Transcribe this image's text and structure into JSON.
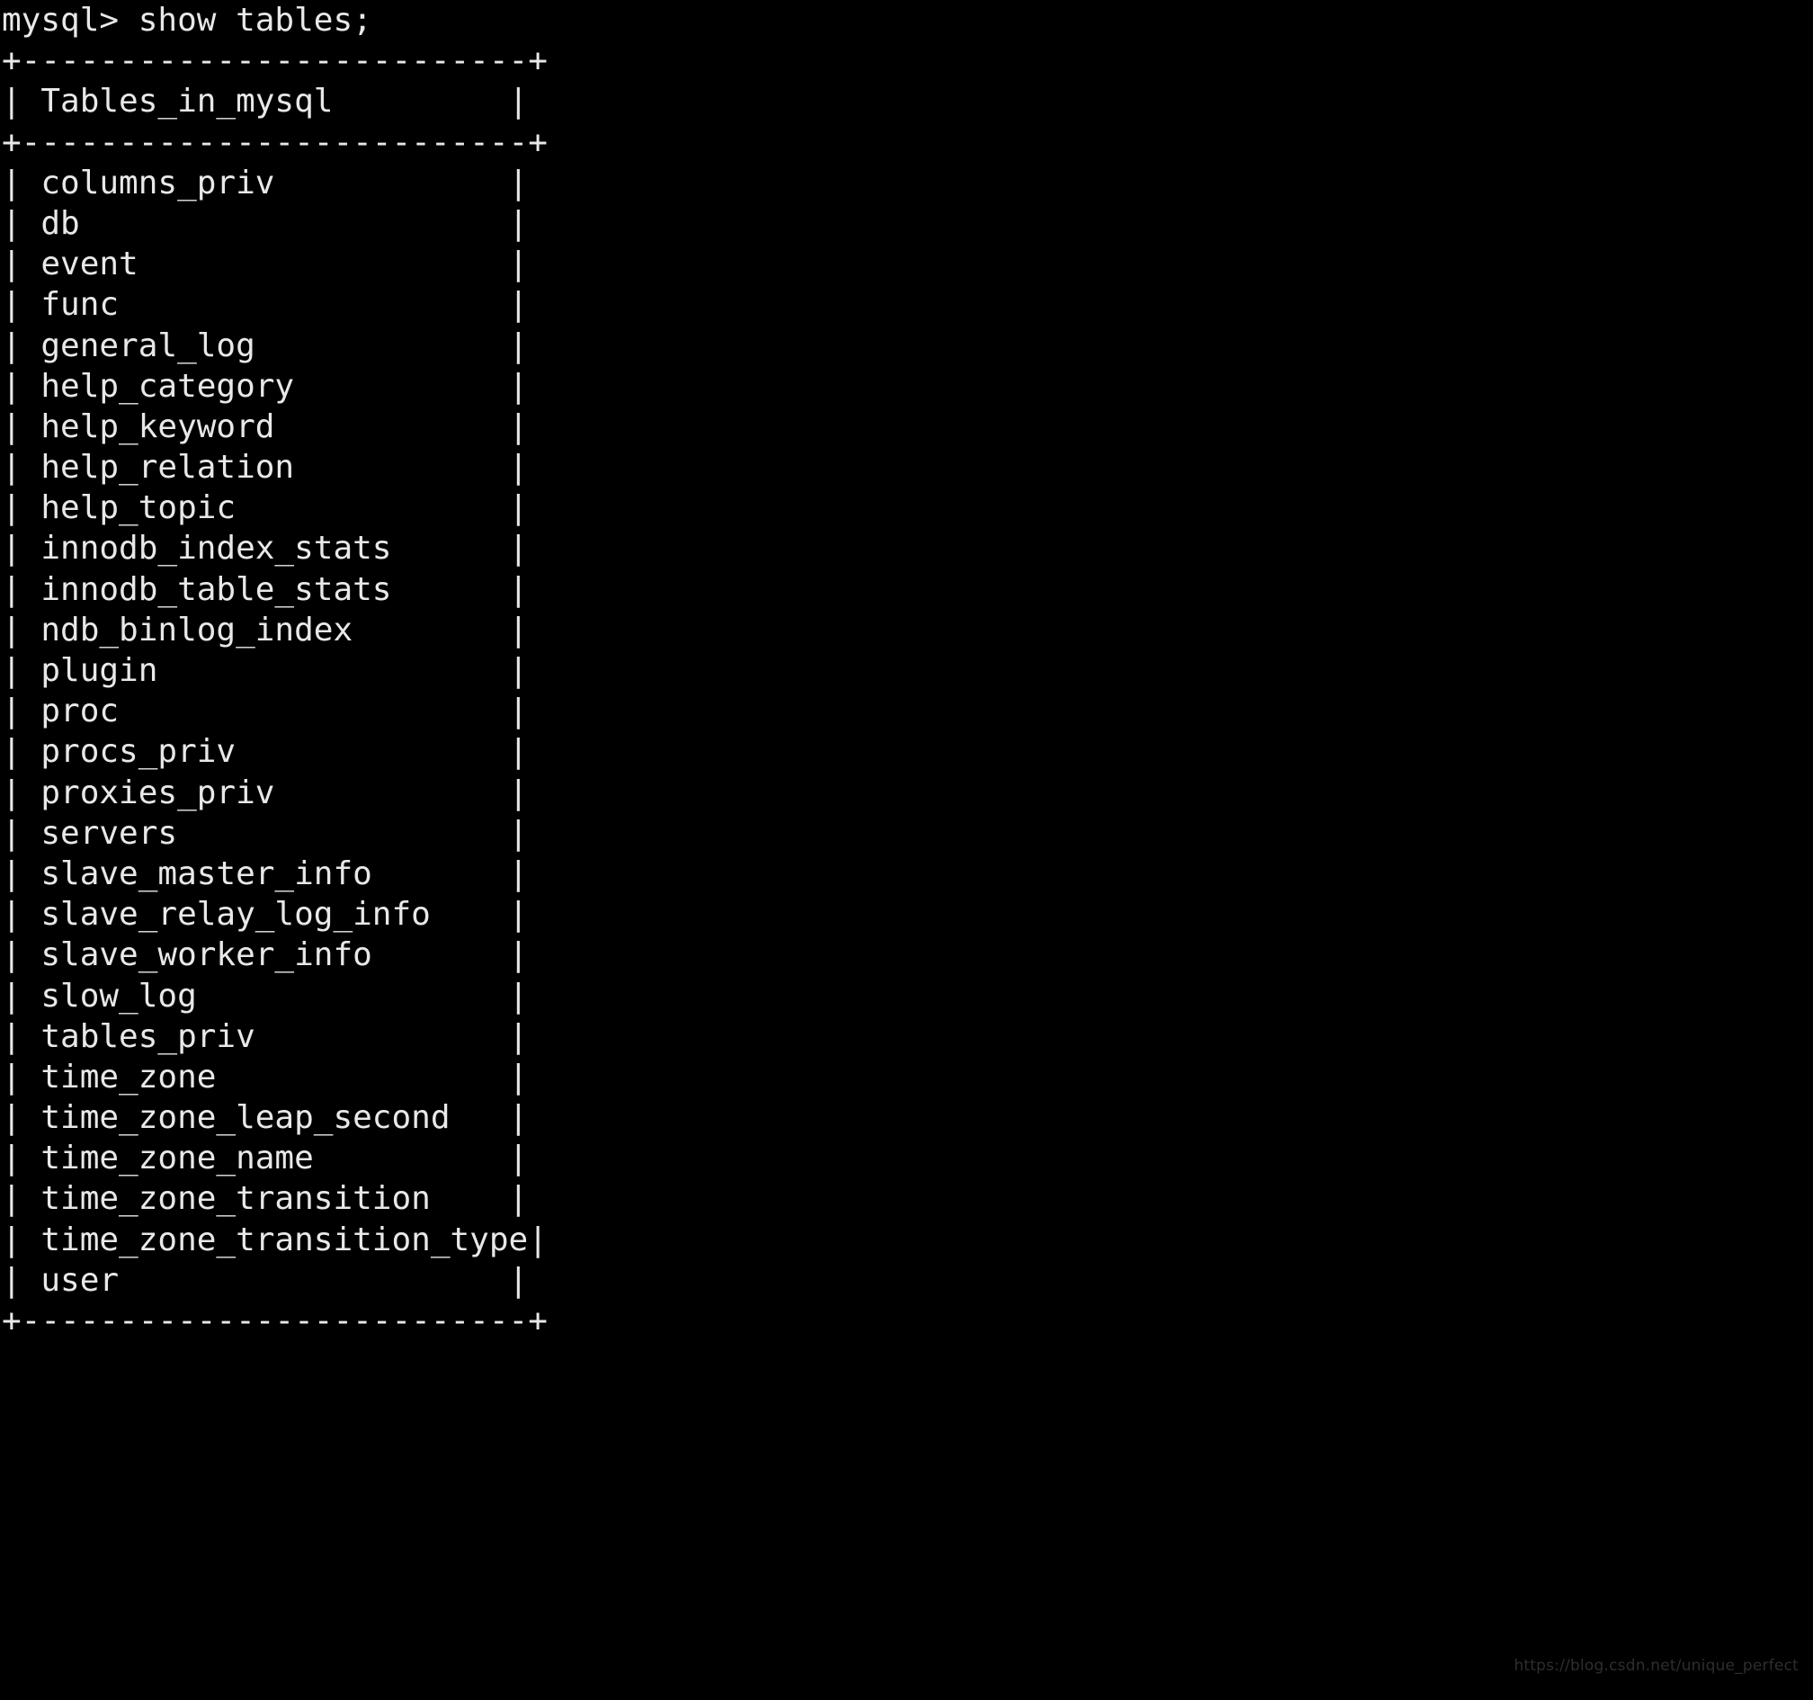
{
  "terminal": {
    "prompt": "mysql> ",
    "command": "show tables;",
    "prompt_line": "mysql> show tables;",
    "column_header": "Tables_in_mysql",
    "separator_rule": "+--------------------------+",
    "border_char_vertical": "|",
    "border_char_corner": "+",
    "border_char_horizontal": "-",
    "inner_width": 26,
    "cell_pad": 24,
    "background_color": "#000000",
    "text_color": "#e8e8e8",
    "rows": [
      "columns_priv",
      "db",
      "event",
      "func",
      "general_log",
      "help_category",
      "help_keyword",
      "help_relation",
      "help_topic",
      "innodb_index_stats",
      "innodb_table_stats",
      "ndb_binlog_index",
      "plugin",
      "proc",
      "procs_priv",
      "proxies_priv",
      "servers",
      "slave_master_info",
      "slave_relay_log_info",
      "slave_worker_info",
      "slow_log",
      "tables_priv",
      "time_zone",
      "time_zone_leap_second",
      "time_zone_name",
      "time_zone_transition",
      "time_zone_transition_type",
      "user"
    ]
  },
  "watermark": {
    "text": "https://blog.csdn.net/unique_perfect",
    "color": "#2e2e2e"
  }
}
